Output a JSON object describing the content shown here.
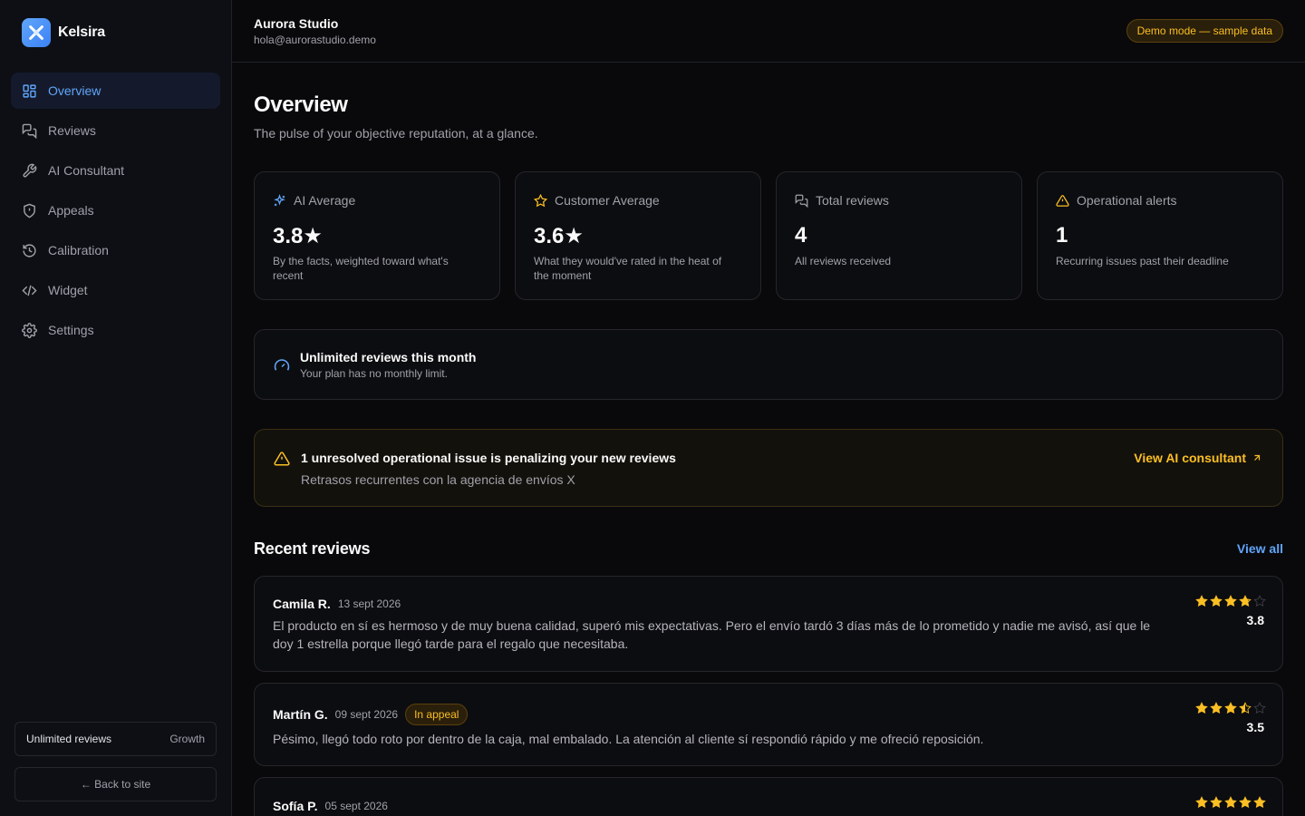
{
  "brand": {
    "name": "Kelsira",
    "accent": "#60a5fa"
  },
  "sidebar": {
    "items": [
      {
        "label": "Overview",
        "icon": "grid-icon",
        "active": true
      },
      {
        "label": "Reviews",
        "icon": "messages-icon"
      },
      {
        "label": "AI Consultant",
        "icon": "wrench-icon"
      },
      {
        "label": "Appeals",
        "icon": "shield-icon"
      },
      {
        "label": "Calibration",
        "icon": "history-icon"
      },
      {
        "label": "Widget",
        "icon": "code-icon"
      },
      {
        "label": "Settings",
        "icon": "gear-icon"
      }
    ],
    "plan": {
      "label": "Unlimited reviews",
      "tier": "Growth"
    },
    "back_label": "← Back to site"
  },
  "header": {
    "org_name": "Aurora Studio",
    "org_email": "hola@aurorastudio.demo",
    "demo_badge": "Demo mode — sample data"
  },
  "page": {
    "title": "Overview",
    "subtitle": "The pulse of your objective reputation, at a glance."
  },
  "stats": [
    {
      "label": "AI Average",
      "value": "3.8★",
      "desc": "By the facts, weighted toward what's recent",
      "icon": "sparkles-icon"
    },
    {
      "label": "Customer Average",
      "value": "3.6★",
      "desc": "What they would've rated in the heat of the moment",
      "icon": "star-outline-icon"
    },
    {
      "label": "Total reviews",
      "value": "4",
      "desc": "All reviews received",
      "icon": "messages-icon"
    },
    {
      "label": "Operational alerts",
      "value": "1",
      "desc": "Recurring issues past their deadline",
      "icon": "warning-icon"
    }
  ],
  "plan_card": {
    "title": "Unlimited reviews this month",
    "subtitle": "Your plan has no monthly limit.",
    "icon": "gauge-icon"
  },
  "alert": {
    "title": "1 unresolved operational issue is penalizing your new reviews",
    "detail": "Retrasos recurrentes con la agencia de envíos X",
    "link": "View AI consultant",
    "icon": "warning-icon"
  },
  "recent": {
    "title": "Recent reviews",
    "view_all": "View all",
    "reviews": [
      {
        "author": "Camila R.",
        "date": "13 sept 2026",
        "text": "El producto en sí es hermoso y de muy buena calidad, superó mis expectativas. Pero el envío tardó 3 días más de lo prometido y nadie me avisó, así que le doy 1 estrella porque llegó tarde para el regalo que necesitaba.",
        "rating": 3.8,
        "score": "3.8"
      },
      {
        "author": "Martín G.",
        "date": "09 sept 2026",
        "badge": "In appeal",
        "text": "Pésimo, llegó todo roto por dentro de la caja, mal embalado. La atención al cliente sí respondió rápido y me ofreció reposición.",
        "rating": 3.5,
        "score": "3.5"
      },
      {
        "author": "Sofía P.",
        "date": "05 sept 2026",
        "text": "",
        "rating": 5,
        "score": ""
      }
    ]
  },
  "colors": {
    "star": "#fbbf24",
    "star_empty": "#3f3f46",
    "warning": "#fbbf24"
  }
}
